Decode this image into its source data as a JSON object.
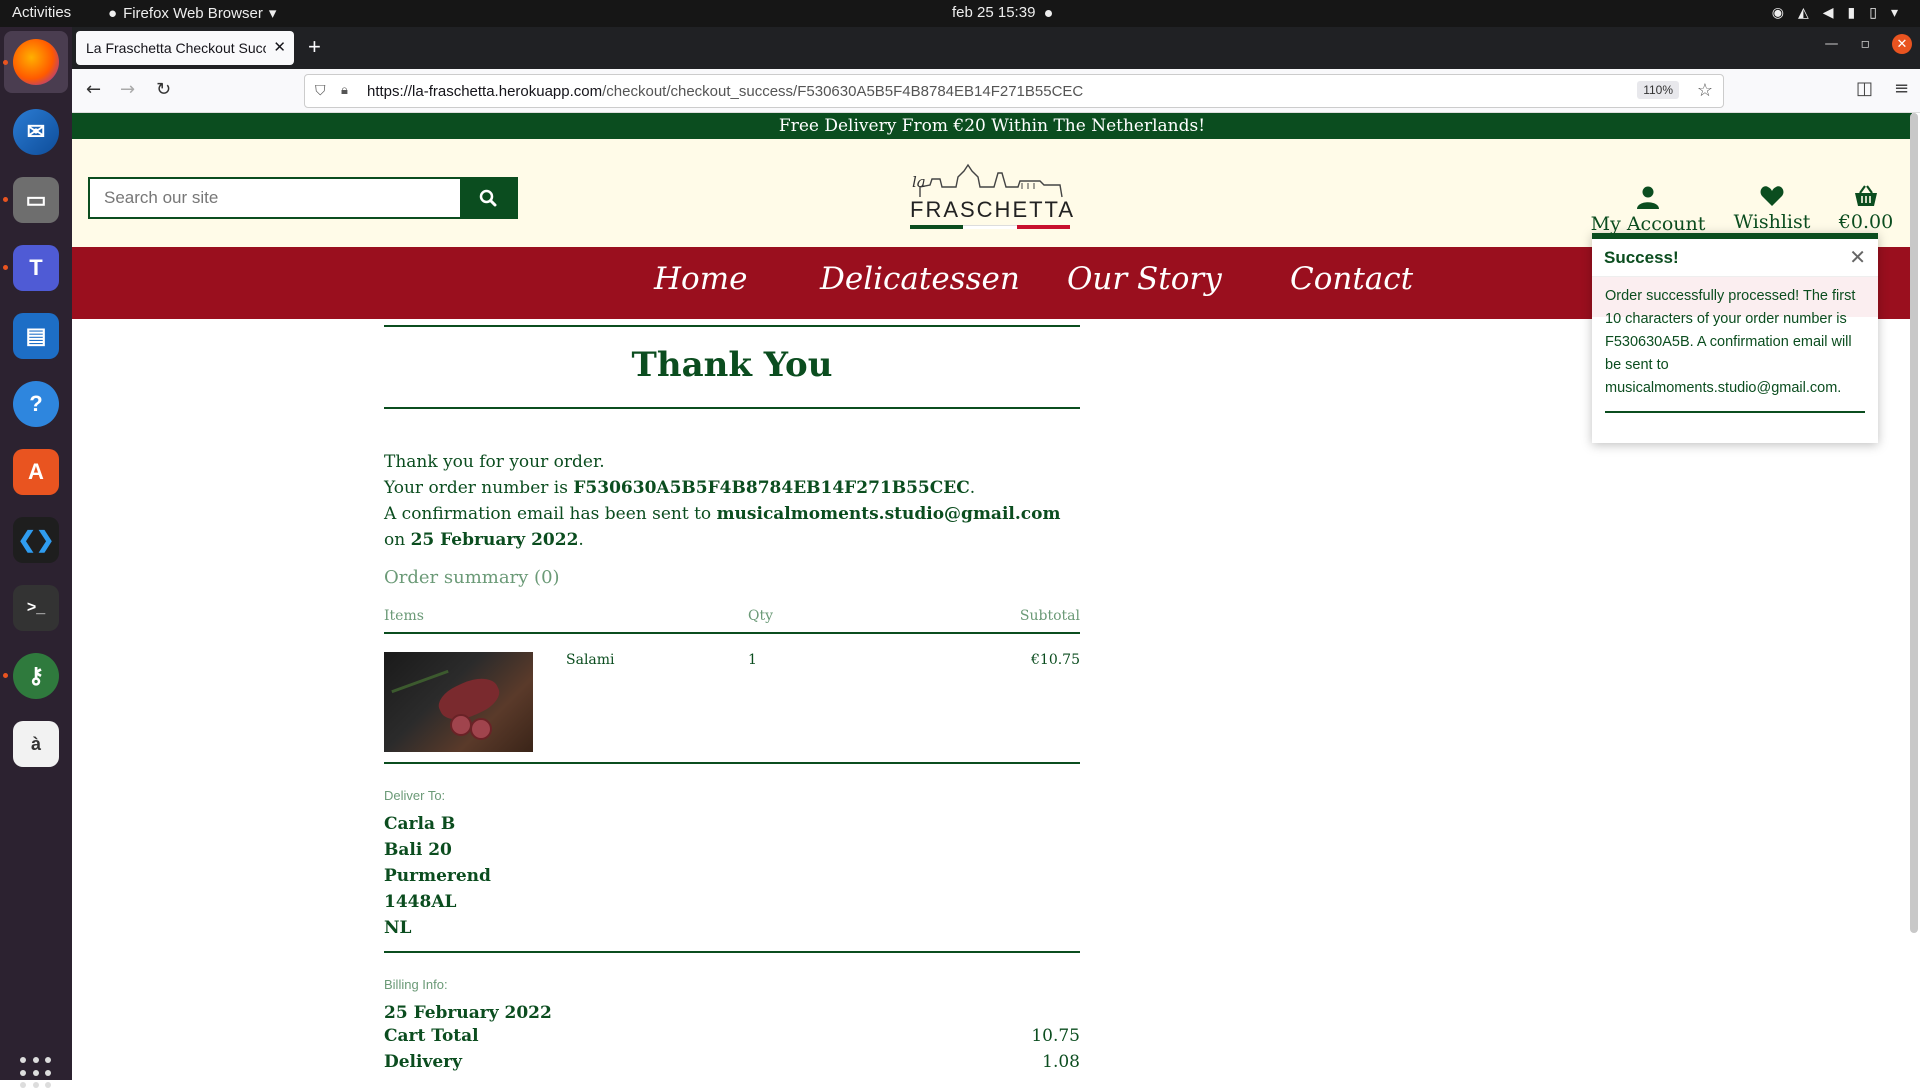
{
  "os": {
    "activities": "Activities",
    "app_name": "Firefox Web Browser",
    "clock": "feb 25  15:39"
  },
  "browser": {
    "tab_title": "La Fraschetta Checkout Succ",
    "url_host": "https://la-fraschetta.herokuapp.com",
    "url_path": "/checkout/checkout_success/F530630A5B5F4B8784EB14F271B55CEC",
    "zoom": "110%"
  },
  "site": {
    "banner": "Free Delivery From €20 Within The Netherlands!",
    "search_placeholder": "Search our site",
    "logo_la": "la",
    "logo_word": "FRASCHETTA",
    "flag_colors": [
      "#0b4d1f",
      "#ffffff",
      "#c8102e"
    ],
    "header_links": {
      "account": "My Account",
      "wishlist": "Wishlist",
      "cart": "€0.00"
    },
    "nav": [
      "Home",
      "Delicatessen",
      "Our Story",
      "Contact"
    ]
  },
  "toast": {
    "title": "Success!",
    "message": "Order successfully processed! The first 10 characters of your order number is F530630A5B. A confirmation email will be sent to musicalmoments.studio@gmail.com."
  },
  "checkout": {
    "title": "Thank You",
    "line1": "Thank you for your order.",
    "line2_prefix": "Your order number is ",
    "order_number": "F530630A5B5F4B8784EB14F271B55CEC",
    "line2_suffix": ".",
    "line3_prefix": "A confirmation email has been sent to ",
    "email": "musicalmoments.studio@gmail.com",
    "line3_mid": " on ",
    "date": "25 February 2022",
    "line3_suffix": ".",
    "summary_title": "Order summary (0)",
    "columns": {
      "items": "Items",
      "qty": "Qty",
      "subtotal": "Subtotal"
    },
    "items": [
      {
        "name": "Salami",
        "qty": "1",
        "subtotal": "€10.75"
      }
    ],
    "deliver_to_label": "Deliver To:",
    "address": [
      "Carla B",
      "Bali 20",
      "Purmerend",
      "1448AL",
      "NL"
    ],
    "billing_label": "Billing Info:",
    "billing_date": "25 February 2022",
    "cart_total_label": "Cart Total",
    "cart_total": "10.75",
    "delivery_label": "Delivery",
    "delivery": "1.08"
  },
  "colors": {
    "brand_green": "#0b4d1f",
    "brand_red": "#9a0f1e",
    "header_bg": "#fffbe8"
  }
}
